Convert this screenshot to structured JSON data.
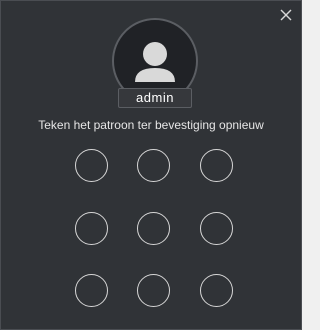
{
  "user": {
    "name": "admin"
  },
  "pattern": {
    "instruction": "Teken het patroon ter bevestiging opnieuw",
    "dots": [
      1,
      2,
      3,
      4,
      5,
      6,
      7,
      8,
      9
    ]
  },
  "icons": {
    "close": "close-icon",
    "avatar": "user-avatar-icon"
  },
  "colors": {
    "background": "#303337",
    "dot_outline": "#d6d6d6",
    "text": "#e6e6e6"
  }
}
